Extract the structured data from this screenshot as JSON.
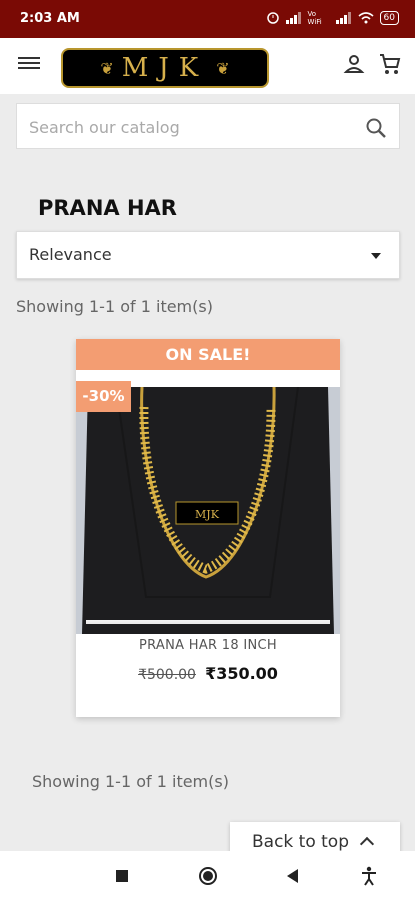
{
  "status_bar": {
    "time": "2:03 AM",
    "network": "Vo WiFi",
    "battery": "60"
  },
  "header": {
    "logo_text": "MJK"
  },
  "search": {
    "placeholder": "Search our catalog"
  },
  "page": {
    "title": "PRANA HAR"
  },
  "sort": {
    "selected": "Relevance"
  },
  "listing": {
    "count_text": "Showing 1-1 of 1 item(s)"
  },
  "products": [
    {
      "badge": "ON SALE!",
      "discount": "-30%",
      "name": "PRANA HAR 18 INCH",
      "regular_price": "₹500.00",
      "price": "₹350.00"
    }
  ],
  "footer": {
    "back_to_top": "Back to top"
  },
  "colors": {
    "status_bar": "#7a0a05",
    "sale_badge": "#f39d72",
    "logo_gold": "#d6b04c"
  }
}
